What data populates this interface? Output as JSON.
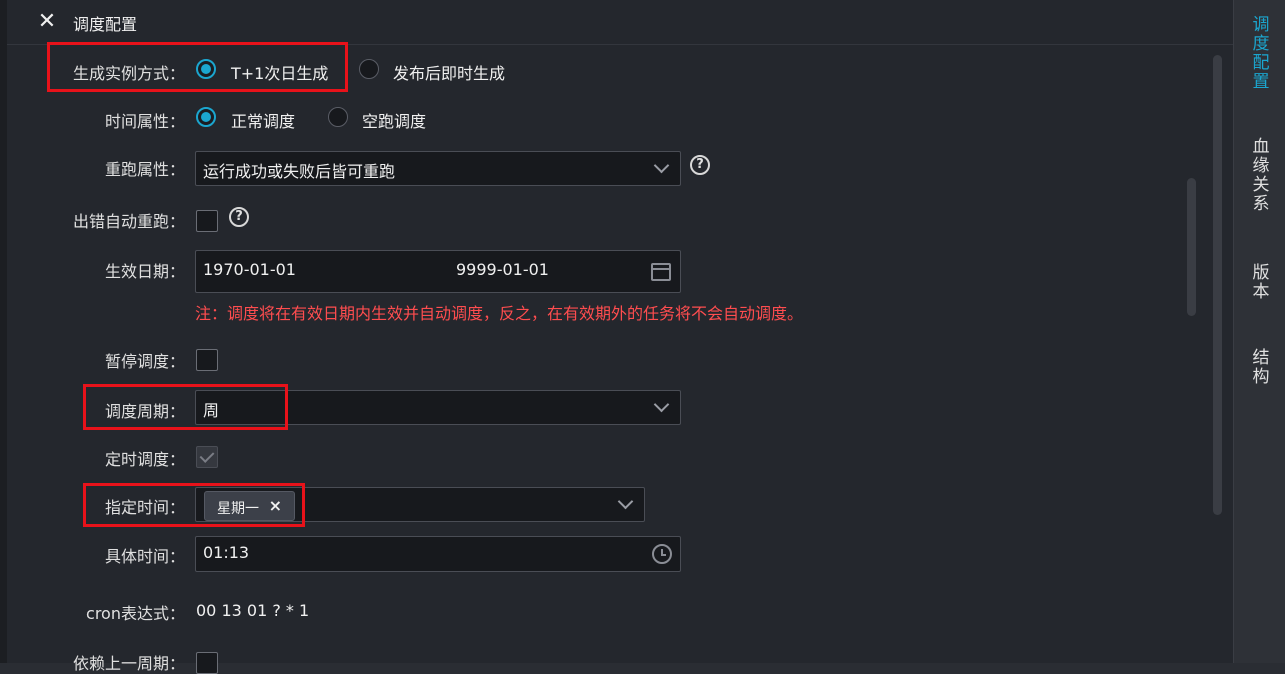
{
  "header": {
    "close_icon": "close-icon",
    "title": "调度配置"
  },
  "form": {
    "instance_mode": {
      "label": "生成实例方式：",
      "options": [
        "T+1次日生成",
        "发布后即时生成"
      ],
      "selected": "T+1次日生成"
    },
    "time_attr": {
      "label": "时间属性：",
      "options": [
        "正常调度",
        "空跑调度"
      ],
      "selected": "正常调度"
    },
    "rerun_attr": {
      "label": "重跑属性：",
      "value": "运行成功或失败后皆可重跑"
    },
    "auto_rerun": {
      "label": "出错自动重跑：",
      "checked": false
    },
    "effective_date": {
      "label": "生效日期：",
      "start": "1970-01-01",
      "end": "9999-01-01",
      "note": "注：调度将在有效日期内生效并自动调度，反之，在有效期外的任务将不会自动调度。"
    },
    "pause": {
      "label": "暂停调度：",
      "checked": false
    },
    "cycle": {
      "label": "调度周期：",
      "value": "周"
    },
    "timed": {
      "label": "定时调度：",
      "checked": true
    },
    "specified_time": {
      "label": "指定时间：",
      "tags": [
        "星期一"
      ]
    },
    "exact_time": {
      "label": "具体时间：",
      "value": "01:13"
    },
    "cron": {
      "label": "cron表达式：",
      "value": "00 13 01 ? * 1"
    },
    "depend_prev": {
      "label": "依赖上一周期：",
      "checked": false
    }
  },
  "right_tabs": [
    {
      "label": "调度配置",
      "active": true
    },
    {
      "label": "血缘关系",
      "active": false
    },
    {
      "label": "版本",
      "active": false
    },
    {
      "label": "结构",
      "active": false
    }
  ],
  "colors": {
    "accent": "#1ba6cf",
    "note": "#ff4d4f",
    "highlight": "#e8121a"
  }
}
